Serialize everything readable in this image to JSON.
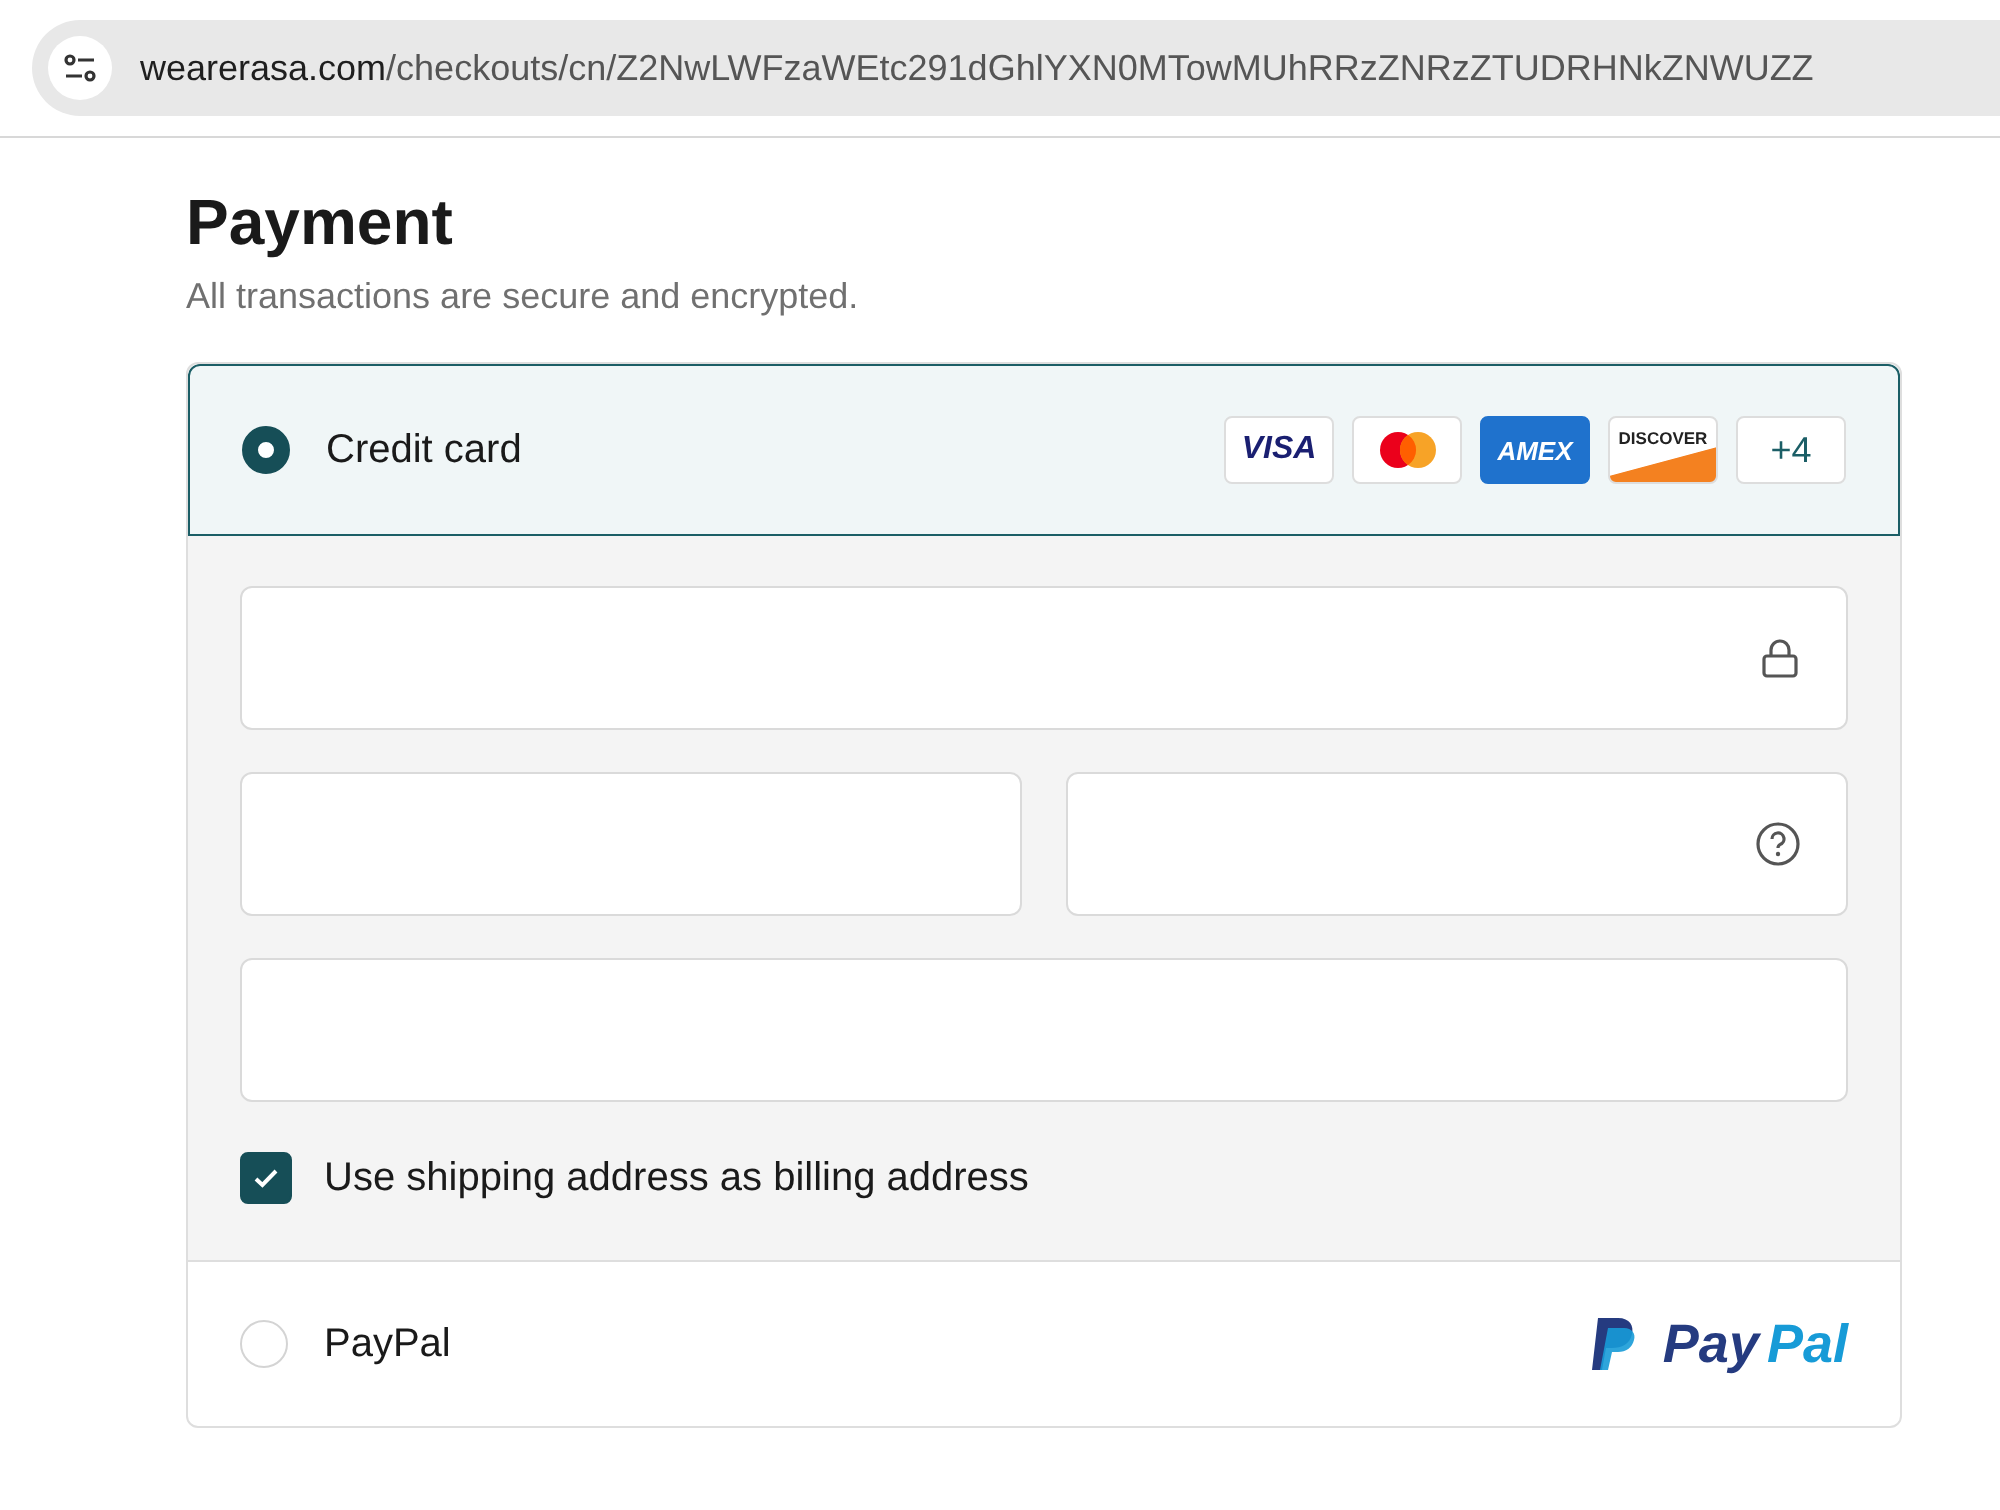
{
  "address_bar": {
    "host": "wearerasa.com",
    "path": "/checkouts/cn/Z2NwLWFzaWEtc291dGhlYXN0MTowMUhRRzZNRzZTUDRHNkZNWUZZ"
  },
  "heading": "Payment",
  "subheading": "All transactions are secure and encrypted.",
  "methods": [
    {
      "kind": "card",
      "label": "Credit card",
      "selected": true,
      "brands": [
        {
          "kind": "visa",
          "text": "VISA"
        },
        {
          "kind": "mastercard"
        },
        {
          "kind": "amex",
          "text": "AMEX"
        },
        {
          "kind": "discover",
          "text": "DISCOVER"
        },
        {
          "kind": "more",
          "text": "+4"
        }
      ],
      "billing": {
        "label": "Use shipping address as billing address",
        "checked": true
      }
    },
    {
      "kind": "paypal",
      "label": "PayPal",
      "selected": false,
      "logo": [
        "Pay",
        "Pal"
      ]
    }
  ]
}
